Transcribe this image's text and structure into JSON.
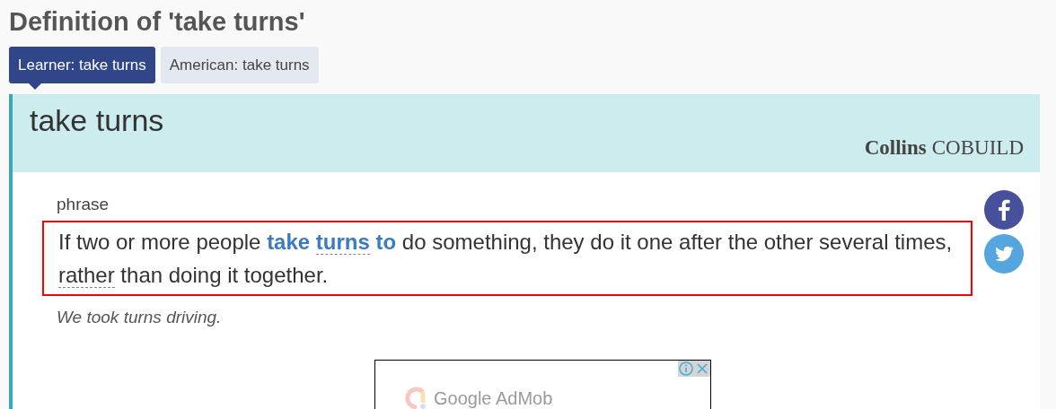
{
  "page_title": "Definition of 'take turns'",
  "tabs": [
    {
      "label": "Learner: take turns",
      "selected": true
    },
    {
      "label": "American: take turns",
      "selected": false
    }
  ],
  "entry": {
    "headword": "take turns",
    "brand_bold": "Collins",
    "brand_light": "COBUILD",
    "part_of_speech": "phrase",
    "definition": [
      {
        "kind": "plain",
        "text": "If two or more people "
      },
      {
        "kind": "headword",
        "text": "take "
      },
      {
        "kind": "headword_link",
        "text": "turns"
      },
      {
        "kind": "headword",
        "text": " to"
      },
      {
        "kind": "plain",
        "text": " do something, they do it one after the other several times, "
      },
      {
        "kind": "link",
        "text": "rather"
      },
      {
        "kind": "plain",
        "text": " than doing it together."
      }
    ],
    "highlighted": true,
    "example": "We took turns driving."
  },
  "share": [
    {
      "kind": "facebook"
    },
    {
      "kind": "twitter"
    }
  ],
  "ad": {
    "label": "Google AdMob"
  }
}
